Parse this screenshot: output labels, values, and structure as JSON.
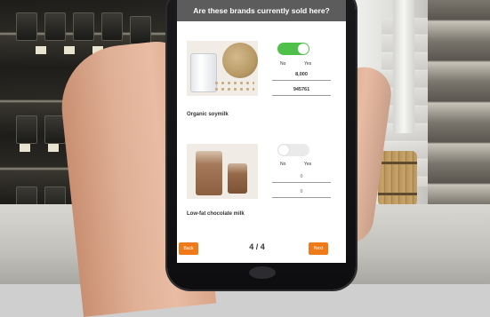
{
  "question": "Are these brands currently sold here?",
  "products": [
    {
      "name": "Organic soymilk",
      "toggle": {
        "on": true,
        "no_label": "No",
        "yes_label": "Yes"
      },
      "field_1": "8,000",
      "field_2": "945761"
    },
    {
      "name": "Low-fat chocolate milk",
      "toggle": {
        "on": false,
        "no_label": "No",
        "yes_label": "Yes"
      },
      "field_1": "0",
      "field_2": "0"
    }
  ],
  "footer": {
    "back_label": "Back",
    "page_indicator": "4 / 4",
    "next_label": "Next"
  },
  "colors": {
    "header_bar": "#5c5c5c",
    "toggle_on": "#4fc14a",
    "toggle_off": "#eaeaea",
    "button": "#f07a1a"
  },
  "icons": [
    "phone-home-button-icon"
  ]
}
